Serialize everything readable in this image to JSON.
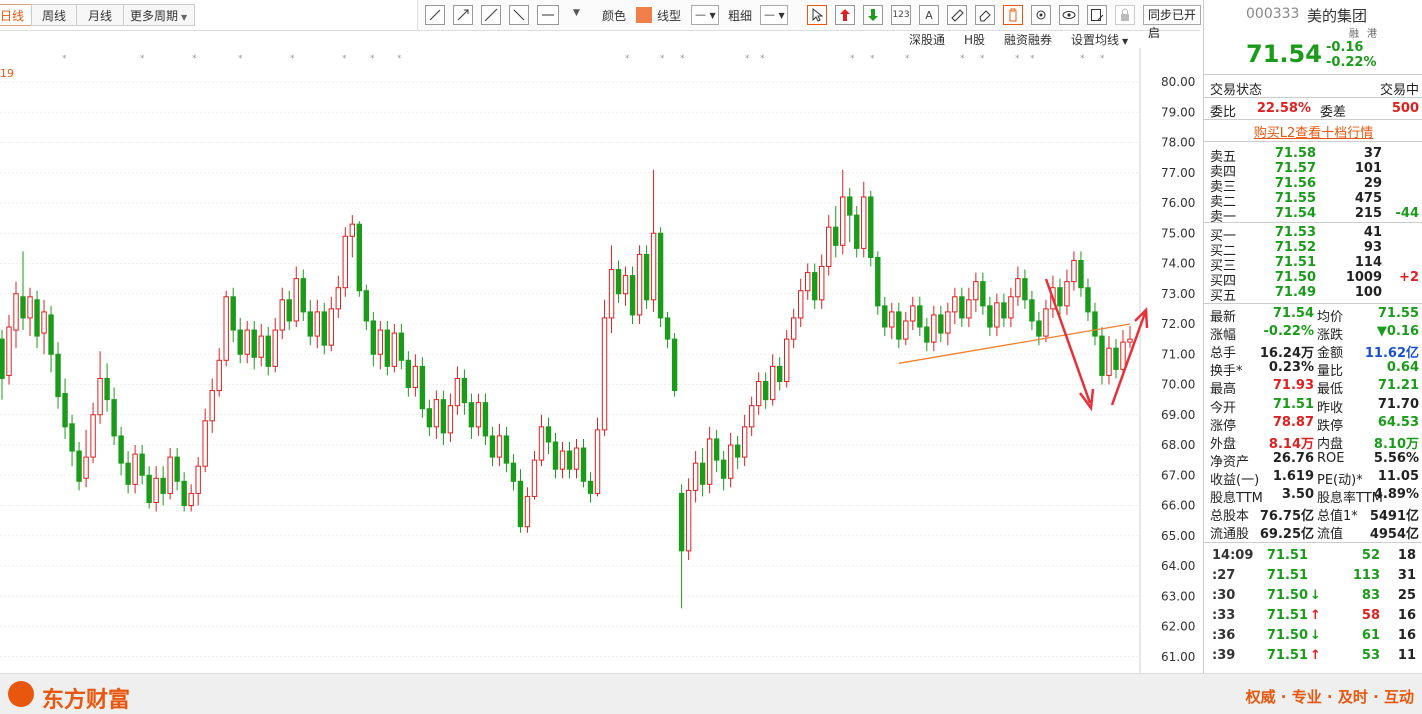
{
  "period_tabs": [
    "日线",
    "周线",
    "月线",
    "更多周期"
  ],
  "draw_toolbar": {
    "color_label": "颜色",
    "line_type_label": "线型",
    "thickness_label": "粗细",
    "sync_button": "同步已开启",
    "accent_color": "#f0804a"
  },
  "links": [
    "深股通",
    "H股",
    "融资融券",
    "设置均线"
  ],
  "chart_left_label": "19",
  "chart_data": {
    "type": "candlestick",
    "y_ticks": [
      "80.00",
      "79.00",
      "78.00",
      "77.00",
      "76.00",
      "75.00",
      "74.00",
      "73.00",
      "72.00",
      "71.00",
      "70.00",
      "69.00",
      "68.00",
      "67.00",
      "66.00",
      "65.00",
      "64.00",
      "63.00",
      "62.00",
      "61.00"
    ],
    "ylim": [
      60.6,
      80.1
    ],
    "up_color": "#e02020",
    "down_color": "#1a9b1a",
    "candles": [
      [
        71.5,
        70.2,
        71.8,
        69.5
      ],
      [
        70.3,
        71.9,
        72.3,
        70.0
      ],
      [
        71.8,
        73.0,
        73.4,
        71.2
      ],
      [
        72.9,
        72.2,
        74.4,
        71.8
      ],
      [
        72.2,
        72.9,
        73.2,
        71.6
      ],
      [
        72.8,
        71.6,
        73.1,
        71.2
      ],
      [
        71.7,
        72.4,
        72.8,
        71.0
      ],
      [
        72.3,
        71.0,
        72.6,
        70.4
      ],
      [
        71.0,
        69.6,
        71.4,
        69.2
      ],
      [
        69.7,
        68.6,
        70.2,
        68.2
      ],
      [
        68.7,
        67.8,
        69.0,
        67.3
      ],
      [
        67.8,
        66.8,
        68.1,
        66.5
      ],
      [
        66.9,
        67.6,
        68.5,
        66.6
      ],
      [
        67.6,
        69.0,
        69.4,
        67.4
      ],
      [
        69.0,
        70.2,
        71.1,
        68.7
      ],
      [
        70.2,
        69.5,
        70.7,
        69.1
      ],
      [
        69.5,
        68.3,
        69.9,
        68.0
      ],
      [
        68.3,
        67.4,
        68.6,
        67.0
      ],
      [
        67.4,
        66.7,
        67.8,
        66.4
      ],
      [
        66.7,
        67.7,
        68.0,
        66.4
      ],
      [
        67.7,
        67.0,
        68.0,
        66.7
      ],
      [
        67.0,
        66.1,
        67.3,
        65.9
      ],
      [
        66.1,
        66.9,
        67.3,
        65.8
      ],
      [
        66.9,
        66.4,
        67.3,
        66.0
      ],
      [
        66.4,
        67.6,
        67.9,
        66.2
      ],
      [
        67.6,
        66.8,
        67.9,
        66.5
      ],
      [
        66.8,
        66.0,
        67.1,
        65.8
      ],
      [
        66.0,
        66.4,
        66.7,
        65.8
      ],
      [
        66.4,
        67.3,
        67.6,
        66.0
      ],
      [
        67.3,
        68.8,
        69.2,
        67.1
      ],
      [
        68.8,
        69.8,
        70.2,
        68.4
      ],
      [
        69.8,
        70.8,
        71.2,
        69.6
      ],
      [
        70.8,
        72.9,
        73.1,
        70.6
      ],
      [
        72.9,
        71.8,
        73.2,
        71.4
      ],
      [
        71.8,
        71.0,
        72.2,
        70.7
      ],
      [
        71.0,
        71.8,
        72.1,
        70.7
      ],
      [
        71.8,
        70.9,
        72.1,
        70.5
      ],
      [
        70.9,
        71.6,
        72.0,
        70.6
      ],
      [
        71.6,
        70.6,
        71.9,
        70.3
      ],
      [
        70.6,
        71.8,
        72.2,
        70.4
      ],
      [
        71.8,
        72.8,
        73.2,
        71.5
      ],
      [
        72.8,
        72.1,
        73.1,
        71.8
      ],
      [
        72.1,
        73.5,
        73.9,
        71.9
      ],
      [
        73.5,
        72.4,
        73.8,
        72.1
      ],
      [
        72.4,
        71.6,
        72.8,
        71.3
      ],
      [
        71.6,
        72.4,
        72.8,
        71.2
      ],
      [
        72.4,
        71.3,
        72.7,
        71.0
      ],
      [
        71.3,
        72.5,
        72.9,
        71.1
      ],
      [
        72.5,
        73.2,
        73.6,
        72.2
      ],
      [
        73.2,
        74.9,
        75.2,
        72.9
      ],
      [
        74.9,
        75.3,
        75.6,
        74.2
      ],
      [
        75.3,
        73.1,
        75.4,
        72.9
      ],
      [
        73.1,
        72.1,
        73.3,
        71.8
      ],
      [
        72.1,
        71.0,
        72.4,
        70.6
      ],
      [
        71.0,
        71.8,
        72.1,
        70.5
      ],
      [
        71.8,
        70.6,
        72.1,
        70.3
      ],
      [
        70.6,
        71.7,
        72.0,
        70.4
      ],
      [
        71.7,
        70.8,
        72.0,
        70.5
      ],
      [
        70.8,
        69.9,
        71.1,
        69.6
      ],
      [
        69.9,
        70.6,
        71.0,
        69.6
      ],
      [
        70.6,
        69.2,
        70.9,
        68.9
      ],
      [
        69.2,
        68.6,
        69.5,
        68.3
      ],
      [
        68.6,
        69.5,
        69.8,
        68.2
      ],
      [
        69.5,
        68.4,
        69.8,
        68.0
      ],
      [
        68.4,
        69.3,
        69.7,
        68.1
      ],
      [
        69.3,
        70.2,
        70.6,
        69.0
      ],
      [
        70.2,
        69.4,
        70.5,
        69.0
      ],
      [
        69.4,
        68.6,
        69.7,
        68.2
      ],
      [
        68.6,
        69.4,
        69.7,
        68.3
      ],
      [
        69.4,
        68.3,
        69.7,
        68.0
      ],
      [
        68.3,
        67.6,
        68.6,
        67.3
      ],
      [
        67.6,
        68.3,
        68.7,
        67.3
      ],
      [
        68.3,
        67.4,
        68.6,
        67.1
      ],
      [
        67.4,
        66.8,
        67.7,
        66.5
      ],
      [
        66.8,
        65.3,
        67.2,
        65.1
      ],
      [
        65.3,
        66.3,
        66.6,
        65.1
      ],
      [
        66.3,
        67.5,
        67.8,
        66.2
      ],
      [
        67.5,
        68.6,
        69.0,
        67.3
      ],
      [
        68.6,
        68.1,
        68.9,
        67.7
      ],
      [
        68.1,
        67.2,
        68.4,
        66.9
      ],
      [
        67.2,
        67.8,
        68.1,
        66.9
      ],
      [
        67.8,
        67.2,
        68.1,
        66.9
      ],
      [
        67.2,
        67.9,
        68.2,
        66.9
      ],
      [
        67.9,
        66.8,
        68.2,
        66.6
      ],
      [
        66.8,
        66.4,
        67.1,
        66.1
      ],
      [
        66.4,
        68.5,
        68.9,
        66.3
      ],
      [
        68.5,
        72.2,
        72.8,
        68.3
      ],
      [
        72.2,
        73.8,
        74.6,
        71.7
      ],
      [
        73.8,
        73.0,
        74.1,
        72.7
      ],
      [
        73.0,
        73.6,
        73.9,
        72.6
      ],
      [
        73.6,
        72.3,
        73.9,
        72.0
      ],
      [
        72.3,
        74.3,
        74.6,
        72.0
      ],
      [
        74.3,
        72.8,
        74.6,
        72.5
      ],
      [
        72.8,
        75.0,
        77.1,
        72.4
      ],
      [
        75.0,
        72.2,
        75.2,
        71.9
      ],
      [
        72.2,
        71.5,
        72.4,
        71.2
      ],
      [
        71.5,
        69.8,
        71.7,
        69.6
      ],
      [
        66.4,
        64.5,
        66.7,
        62.6
      ],
      [
        64.5,
        66.5,
        66.9,
        64.2
      ],
      [
        66.5,
        67.4,
        67.8,
        66.1
      ],
      [
        67.4,
        66.7,
        67.9,
        66.3
      ],
      [
        66.7,
        68.2,
        68.6,
        66.4
      ],
      [
        68.2,
        67.5,
        68.5,
        67.1
      ],
      [
        67.5,
        66.9,
        67.8,
        66.5
      ],
      [
        66.9,
        68.0,
        68.4,
        66.6
      ],
      [
        68.0,
        67.6,
        68.3,
        67.2
      ],
      [
        67.6,
        68.6,
        69.0,
        67.3
      ],
      [
        68.6,
        69.3,
        69.6,
        68.3
      ],
      [
        69.3,
        70.1,
        70.4,
        69.0
      ],
      [
        70.1,
        69.5,
        70.4,
        69.2
      ],
      [
        69.5,
        70.6,
        71.0,
        69.3
      ],
      [
        70.6,
        70.1,
        70.9,
        69.8
      ],
      [
        70.1,
        71.5,
        71.8,
        69.9
      ],
      [
        71.5,
        72.2,
        72.5,
        71.2
      ],
      [
        72.2,
        73.1,
        73.5,
        71.9
      ],
      [
        73.1,
        73.7,
        74.0,
        72.8
      ],
      [
        73.7,
        72.8,
        74.0,
        72.5
      ],
      [
        72.8,
        73.9,
        74.3,
        72.5
      ],
      [
        73.9,
        75.2,
        75.6,
        73.6
      ],
      [
        75.2,
        74.6,
        75.9,
        74.2
      ],
      [
        74.6,
        76.2,
        77.1,
        74.3
      ],
      [
        76.2,
        75.6,
        76.5,
        74.7
      ],
      [
        75.6,
        74.5,
        75.9,
        74.2
      ],
      [
        74.5,
        76.2,
        76.7,
        74.2
      ],
      [
        76.2,
        74.2,
        76.4,
        73.9
      ],
      [
        74.2,
        72.6,
        74.4,
        72.3
      ],
      [
        72.6,
        71.9,
        72.9,
        71.6
      ],
      [
        71.9,
        72.4,
        72.7,
        71.5
      ],
      [
        72.4,
        71.5,
        72.7,
        71.2
      ],
      [
        71.5,
        72.1,
        72.4,
        71.3
      ],
      [
        72.1,
        72.6,
        72.9,
        71.8
      ],
      [
        72.6,
        71.9,
        72.9,
        71.6
      ],
      [
        71.9,
        71.4,
        72.2,
        71.1
      ],
      [
        71.4,
        72.3,
        72.6,
        71.1
      ],
      [
        72.3,
        71.7,
        72.6,
        71.4
      ],
      [
        71.7,
        72.4,
        72.7,
        71.3
      ],
      [
        72.4,
        72.9,
        73.2,
        72.0
      ],
      [
        72.9,
        72.2,
        73.2,
        71.9
      ],
      [
        72.2,
        72.8,
        73.2,
        71.9
      ],
      [
        72.8,
        73.4,
        73.7,
        72.4
      ],
      [
        73.4,
        72.6,
        73.7,
        72.3
      ],
      [
        72.6,
        71.9,
        72.9,
        71.6
      ],
      [
        71.9,
        72.7,
        73.0,
        71.6
      ],
      [
        72.7,
        72.2,
        73.0,
        71.9
      ],
      [
        72.2,
        72.9,
        73.2,
        71.9
      ],
      [
        72.9,
        73.5,
        73.9,
        72.6
      ],
      [
        73.5,
        72.8,
        73.8,
        72.5
      ],
      [
        72.8,
        72.1,
        73.1,
        71.8
      ],
      [
        72.1,
        71.6,
        72.4,
        71.3
      ],
      [
        71.6,
        72.5,
        72.8,
        71.4
      ],
      [
        72.5,
        73.2,
        73.6,
        72.2
      ],
      [
        73.2,
        72.6,
        73.5,
        72.2
      ],
      [
        72.6,
        73.4,
        73.8,
        72.3
      ],
      [
        73.4,
        74.1,
        74.4,
        73.1
      ],
      [
        74.1,
        73.2,
        74.4,
        72.9
      ],
      [
        73.2,
        72.4,
        73.5,
        72.1
      ],
      [
        72.4,
        71.6,
        72.7,
        71.3
      ],
      [
        71.6,
        70.3,
        71.9,
        70.0
      ],
      [
        70.3,
        71.2,
        71.6,
        70.0
      ],
      [
        71.2,
        70.5,
        71.5,
        70.2
      ],
      [
        70.5,
        71.4,
        71.8,
        70.3
      ],
      [
        71.4,
        71.5,
        71.93,
        71.21
      ]
    ],
    "trendline": [
      [
        128,
        70.7
      ],
      [
        161,
        72.0
      ]
    ]
  },
  "stock": {
    "code": "000333",
    "name": "美的集团",
    "tags": [
      "融",
      "港"
    ],
    "price": "71.54",
    "change": "-0.16",
    "change_pct": "-0.22%"
  },
  "trade_status": {
    "label": "交易状态",
    "value": "交易中"
  },
  "ratio": {
    "l1": "委比",
    "v1": "22.58%",
    "l2": "委差",
    "v2": "500"
  },
  "l2_link": "购买L2查看十档行情",
  "sell_orders": [
    {
      "label": "卖五",
      "price": "71.58",
      "vol": "37",
      "chg": ""
    },
    {
      "label": "卖四",
      "price": "71.57",
      "vol": "101",
      "chg": ""
    },
    {
      "label": "卖三",
      "price": "71.56",
      "vol": "29",
      "chg": ""
    },
    {
      "label": "卖二",
      "price": "71.55",
      "vol": "475",
      "chg": ""
    },
    {
      "label": "卖一",
      "price": "71.54",
      "vol": "215",
      "chg": "-44"
    }
  ],
  "buy_orders": [
    {
      "label": "买一",
      "price": "71.53",
      "vol": "41",
      "chg": ""
    },
    {
      "label": "买二",
      "price": "71.52",
      "vol": "93",
      "chg": ""
    },
    {
      "label": "买三",
      "price": "71.51",
      "vol": "114",
      "chg": ""
    },
    {
      "label": "买四",
      "price": "71.50",
      "vol": "1009",
      "chg": "+2"
    },
    {
      "label": "买五",
      "price": "71.49",
      "vol": "100",
      "chg": ""
    }
  ],
  "stats": [
    {
      "l1": "最新",
      "v1": "71.54",
      "c1": "green",
      "l2": "均价",
      "v2": "71.55",
      "c2": "green"
    },
    {
      "l1": "涨幅",
      "v1": "-0.22%",
      "c1": "green",
      "l2": "涨跌",
      "v2": "▼0.16",
      "c2": "green"
    },
    {
      "l1": "总手",
      "v1": "16.24万",
      "c1": "dark",
      "l2": "金额",
      "v2": "11.62亿",
      "c2": "blue"
    },
    {
      "l1": "换手*",
      "v1": "0.23%",
      "c1": "dark",
      "l2": "量比",
      "v2": "0.64",
      "c2": "green"
    },
    {
      "l1": "最高",
      "v1": "71.93",
      "c1": "red",
      "l2": "最低",
      "v2": "71.21",
      "c2": "green"
    },
    {
      "l1": "今开",
      "v1": "71.51",
      "c1": "green",
      "l2": "昨收",
      "v2": "71.70",
      "c2": "dark"
    },
    {
      "l1": "涨停",
      "v1": "78.87",
      "c1": "red",
      "l2": "跌停",
      "v2": "64.53",
      "c2": "green"
    },
    {
      "l1": "外盘",
      "v1": "8.14万",
      "c1": "red",
      "l2": "内盘",
      "v2": "8.10万",
      "c2": "green"
    },
    {
      "l1": "净资产",
      "v1": "26.76",
      "c1": "dark",
      "l2": "ROE",
      "v2": "5.56%",
      "c2": "dark"
    },
    {
      "l1": "收益(一)",
      "v1": "1.619",
      "c1": "dark",
      "l2": "PE(动)*",
      "v2": "11.05",
      "c2": "dark"
    },
    {
      "l1": "股息TTM",
      "v1": "3.50",
      "c1": "dark",
      "l2": "股息率TTM",
      "v2": "4.89%",
      "c2": "dark"
    },
    {
      "l1": "总股本",
      "v1": "76.75亿",
      "c1": "dark",
      "l2": "总值1*",
      "v2": "5491亿",
      "c2": "dark"
    },
    {
      "l1": "流通股",
      "v1": "69.25亿",
      "c1": "dark",
      "l2": "流值",
      "v2": "4954亿",
      "c2": "dark"
    }
  ],
  "ticks": [
    {
      "time": "14:09",
      "price": "71.51",
      "arrow": "",
      "vol": "52",
      "vc": "green",
      "n": "18"
    },
    {
      "time": ":27",
      "price": "71.51",
      "arrow": "",
      "vol": "113",
      "vc": "green",
      "n": "31"
    },
    {
      "time": ":30",
      "price": "71.50",
      "arrow": "↓",
      "vol": "83",
      "vc": "green",
      "n": "25"
    },
    {
      "time": ":33",
      "price": "71.51",
      "arrow": "↑",
      "vol": "58",
      "vc": "red",
      "n": "16"
    },
    {
      "time": ":36",
      "price": "71.50",
      "arrow": "↓",
      "vol": "61",
      "vc": "green",
      "n": "16"
    },
    {
      "time": ":39",
      "price": "71.51",
      "arrow": "↑",
      "vol": "53",
      "vc": "green",
      "n": "11"
    }
  ],
  "footer": {
    "brand": "东方财富",
    "slogan": "权威 · 专业 · 及时 · 互动"
  }
}
